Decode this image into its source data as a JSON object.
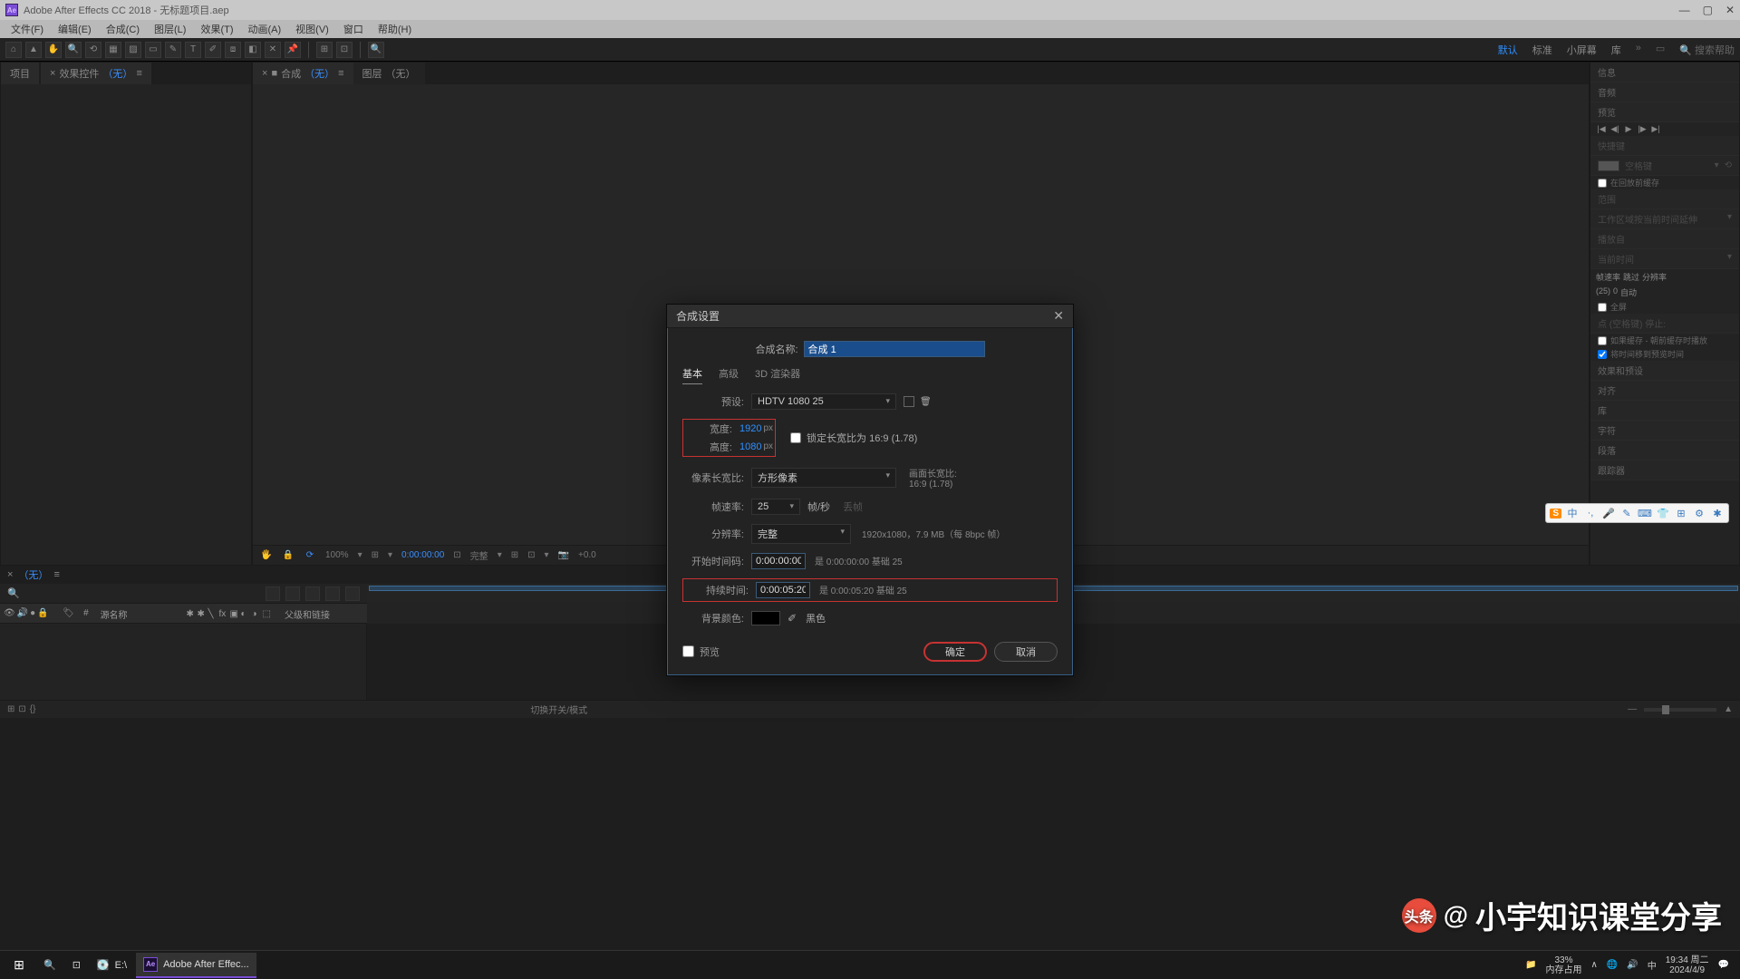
{
  "titlebar": {
    "app_icon": "Ae",
    "title": "Adobe After Effects CC 2018 - 无标题项目.aep"
  },
  "menu": [
    "文件(F)",
    "编辑(E)",
    "合成(C)",
    "图层(L)",
    "效果(T)",
    "动画(A)",
    "视图(V)",
    "窗口",
    "帮助(H)"
  ],
  "workspaces": {
    "active": "默认",
    "others": [
      "标准",
      "小屏幕",
      "库"
    ],
    "extra": [
      "»",
      "▭",
      "🔍 搜索帮助"
    ]
  },
  "project": {
    "tab1": "项目",
    "tab2_prefix": "效果控件",
    "none": "（无）",
    "menu": "≡"
  },
  "viewer": {
    "tab1_prefix": "合成",
    "tab1_none": "（无）",
    "tab2_prefix": "图层",
    "tab2_none": "（无）",
    "footer_items": [
      "🖐",
      "🔒",
      "⟳",
      "100%",
      "▾",
      "⊞",
      "▾",
      "0:00:00:00",
      "⊡",
      "完整",
      "▾",
      "⊞",
      "⊡",
      "▾",
      "📷",
      "+0.0"
    ]
  },
  "right_panels": {
    "info": "信息",
    "audio": "音频",
    "preview": "预览",
    "play_ctls": [
      "|◀",
      "◀|",
      "▶",
      "|▶",
      "▶|"
    ],
    "shortcut": "快捷键",
    "spacebar": "空格键",
    "cache_before_play": "在回放前缓存",
    "range": "范围",
    "work_area_extend": "工作区域按当前时间延伸",
    "play_from": "播放自",
    "current_time": "当前时间",
    "fps": "帧速率",
    "fps_val": "(25)",
    "skip": "跳过",
    "skip_val": "0",
    "res": "分辨率",
    "res_val": "自动",
    "fullscreen": "全屏",
    "pointer_note": "点 (空格键) 停止:",
    "if_cached": "如果缓存 - 朝前缓存时播放",
    "move_time": "将时间移到预览时间",
    "effects": "效果和预设",
    "align": "对齐",
    "lib": "库",
    "char": "字符",
    "para": "段落",
    "tracker": "跟踪器"
  },
  "timeline": {
    "tab_none": "（无）",
    "menu": "≡",
    "col_name": "源名称",
    "col_parent": "父级和链接",
    "mode_label": "切换开关/模式"
  },
  "dialog": {
    "title": "合成设置",
    "name_label": "合成名称:",
    "name_value": "合成 1",
    "tabs": [
      "基本",
      "高级",
      "3D 渲染器"
    ],
    "preset_label": "预设:",
    "preset_value": "HDTV 1080 25",
    "width_label": "宽度:",
    "width_value": "1920",
    "px": "px",
    "height_label": "高度:",
    "height_value": "1080",
    "lock_aspect": "锁定长宽比为 16:9 (1.78)",
    "par_label": "像素长宽比:",
    "par_value": "方形像素",
    "far_label": "画面长宽比:",
    "far_value": "16:9 (1.78)",
    "fps_label": "帧速率:",
    "fps_value": "25",
    "fps_unit": "帧/秒",
    "fps_drop": "丢帧",
    "res_label": "分辨率:",
    "res_value": "完整",
    "res_info": "1920x1080，7.9 MB（每 8bpc 帧）",
    "start_label": "开始时间码:",
    "start_value": "0:00:00:00",
    "start_info": "是 0:00:00:00 基础 25",
    "dur_label": "持续时间:",
    "dur_value": "0:00:05:20",
    "dur_info": "是 0:00:05:20 基础 25",
    "bg_label": "背景颜色:",
    "bg_name": "黑色",
    "preview_chk": "预览",
    "ok": "确定",
    "cancel": "取消"
  },
  "ime": {
    "logo": "S",
    "items": [
      "中",
      "·,",
      "🎤",
      "✎",
      "⌨",
      "👕",
      "⊞",
      "⚙",
      "✱"
    ]
  },
  "watermark": {
    "brand": "头条",
    "at": "@",
    "name": "小宇知识课堂分享"
  },
  "taskbar": {
    "drive": "E:\\",
    "ae": "Adobe After Effec...",
    "tray_items": [
      "📁",
      "∧",
      "🌐",
      "🔊",
      "中"
    ],
    "mem_pct": "33%",
    "mem_lbl": "内存占用",
    "time": "19:34 周二",
    "date": "2024/4/9"
  }
}
